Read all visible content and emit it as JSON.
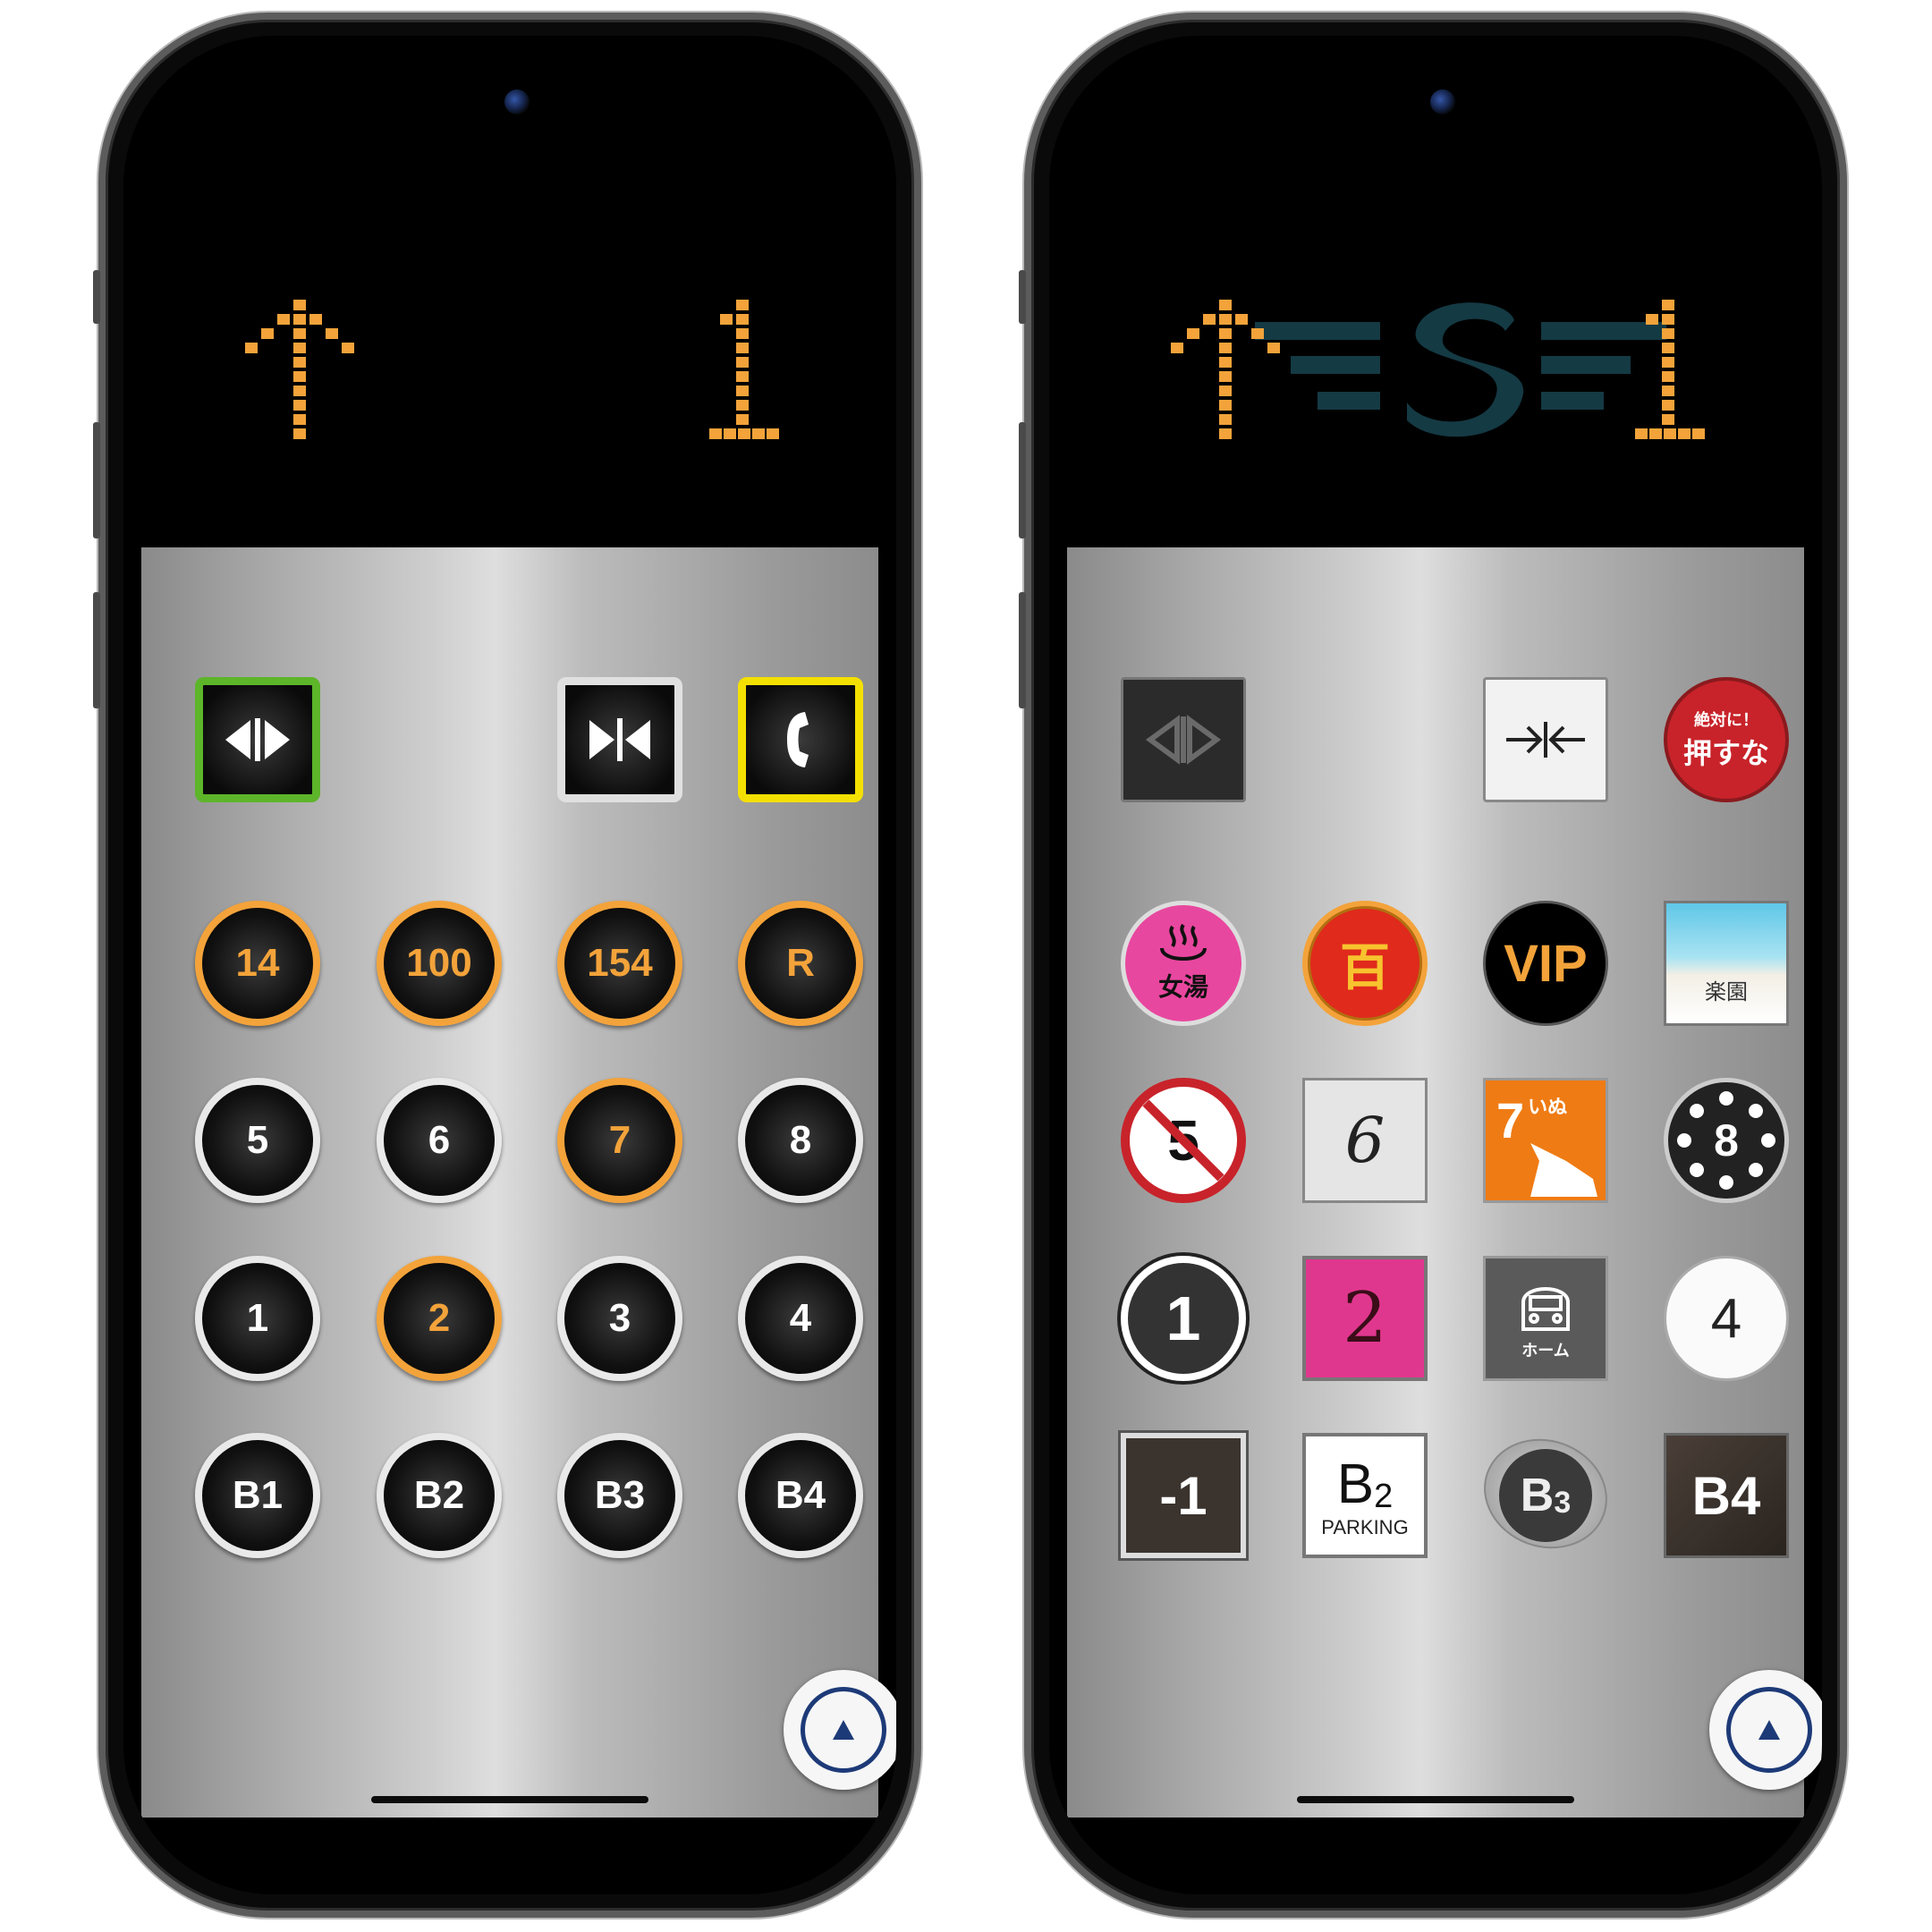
{
  "left_phone": {
    "indicator": {
      "direction": "up",
      "floor": "1"
    },
    "control_buttons": [
      {
        "name": "open-door",
        "label": "◀|▶",
        "border": "#5db52a"
      },
      {
        "name": "close-door",
        "label": "▶|◀",
        "border": "#e0e0e0"
      },
      {
        "name": "call",
        "label": "☎",
        "border": "#f4e000"
      }
    ],
    "floor_rows": [
      [
        {
          "label": "14",
          "lit": true
        },
        {
          "label": "100",
          "lit": true
        },
        {
          "label": "154",
          "lit": true
        },
        {
          "label": "R",
          "lit": true
        }
      ],
      [
        {
          "label": "5",
          "lit": false
        },
        {
          "label": "6",
          "lit": false
        },
        {
          "label": "7",
          "lit": true
        },
        {
          "label": "8",
          "lit": false
        }
      ],
      [
        {
          "label": "1",
          "lit": false
        },
        {
          "label": "2",
          "lit": true
        },
        {
          "label": "3",
          "lit": false
        },
        {
          "label": "4",
          "lit": false
        }
      ],
      [
        {
          "label": "B1",
          "lit": false
        },
        {
          "label": "B2",
          "lit": false
        },
        {
          "label": "B3",
          "lit": false
        },
        {
          "label": "B4",
          "lit": false
        }
      ]
    ]
  },
  "right_phone": {
    "indicator": {
      "direction": "up",
      "floor": "1",
      "logo": "S"
    },
    "top_buttons": {
      "open_label": "◁▷",
      "close_label": "→←",
      "dont_push_small": "絶対に！",
      "dont_push_big": "押すな"
    },
    "row1": {
      "onsen_label": "女湯",
      "hundred_label": "百",
      "vip_label": "VIP",
      "paradise_label": "楽園"
    },
    "row2": {
      "five_label": "5",
      "six_label": "6",
      "seven_label": "7",
      "seven_sub": "いぬ",
      "eight_label": "8"
    },
    "row3": {
      "one_label": "1",
      "two_label": "2",
      "home_label": "ホーム",
      "four_label": "4"
    },
    "row4": {
      "minus_one_label": "-1",
      "b2_main": "B",
      "b2_sub": "2",
      "b2_caption": "PARKING",
      "b3_main": "B",
      "b3_sub": "3",
      "b4_label": "B4"
    }
  },
  "colors": {
    "amber": "#f3a33a",
    "green": "#5db52a",
    "yellow": "#f4e000",
    "navy": "#1d3a78"
  }
}
